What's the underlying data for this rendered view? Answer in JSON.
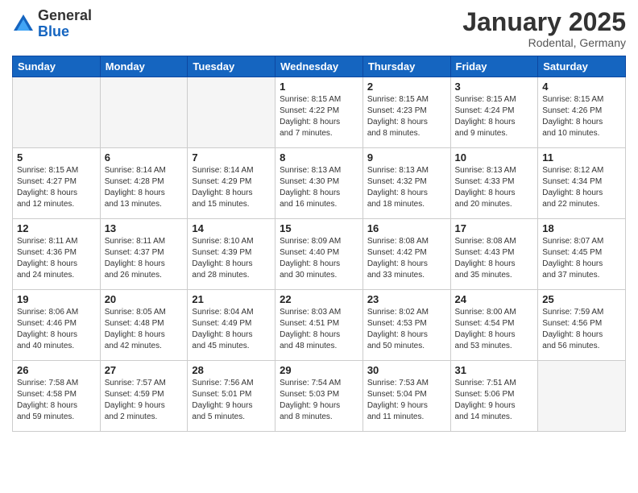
{
  "logo": {
    "general": "General",
    "blue": "Blue"
  },
  "title": "January 2025",
  "location": "Rodental, Germany",
  "days": [
    "Sunday",
    "Monday",
    "Tuesday",
    "Wednesday",
    "Thursday",
    "Friday",
    "Saturday"
  ],
  "weeks": [
    [
      {
        "day": "",
        "content": ""
      },
      {
        "day": "",
        "content": ""
      },
      {
        "day": "",
        "content": ""
      },
      {
        "day": "1",
        "content": "Sunrise: 8:15 AM\nSunset: 4:22 PM\nDaylight: 8 hours\nand 7 minutes."
      },
      {
        "day": "2",
        "content": "Sunrise: 8:15 AM\nSunset: 4:23 PM\nDaylight: 8 hours\nand 8 minutes."
      },
      {
        "day": "3",
        "content": "Sunrise: 8:15 AM\nSunset: 4:24 PM\nDaylight: 8 hours\nand 9 minutes."
      },
      {
        "day": "4",
        "content": "Sunrise: 8:15 AM\nSunset: 4:26 PM\nDaylight: 8 hours\nand 10 minutes."
      }
    ],
    [
      {
        "day": "5",
        "content": "Sunrise: 8:15 AM\nSunset: 4:27 PM\nDaylight: 8 hours\nand 12 minutes."
      },
      {
        "day": "6",
        "content": "Sunrise: 8:14 AM\nSunset: 4:28 PM\nDaylight: 8 hours\nand 13 minutes."
      },
      {
        "day": "7",
        "content": "Sunrise: 8:14 AM\nSunset: 4:29 PM\nDaylight: 8 hours\nand 15 minutes."
      },
      {
        "day": "8",
        "content": "Sunrise: 8:13 AM\nSunset: 4:30 PM\nDaylight: 8 hours\nand 16 minutes."
      },
      {
        "day": "9",
        "content": "Sunrise: 8:13 AM\nSunset: 4:32 PM\nDaylight: 8 hours\nand 18 minutes."
      },
      {
        "day": "10",
        "content": "Sunrise: 8:13 AM\nSunset: 4:33 PM\nDaylight: 8 hours\nand 20 minutes."
      },
      {
        "day": "11",
        "content": "Sunrise: 8:12 AM\nSunset: 4:34 PM\nDaylight: 8 hours\nand 22 minutes."
      }
    ],
    [
      {
        "day": "12",
        "content": "Sunrise: 8:11 AM\nSunset: 4:36 PM\nDaylight: 8 hours\nand 24 minutes."
      },
      {
        "day": "13",
        "content": "Sunrise: 8:11 AM\nSunset: 4:37 PM\nDaylight: 8 hours\nand 26 minutes."
      },
      {
        "day": "14",
        "content": "Sunrise: 8:10 AM\nSunset: 4:39 PM\nDaylight: 8 hours\nand 28 minutes."
      },
      {
        "day": "15",
        "content": "Sunrise: 8:09 AM\nSunset: 4:40 PM\nDaylight: 8 hours\nand 30 minutes."
      },
      {
        "day": "16",
        "content": "Sunrise: 8:08 AM\nSunset: 4:42 PM\nDaylight: 8 hours\nand 33 minutes."
      },
      {
        "day": "17",
        "content": "Sunrise: 8:08 AM\nSunset: 4:43 PM\nDaylight: 8 hours\nand 35 minutes."
      },
      {
        "day": "18",
        "content": "Sunrise: 8:07 AM\nSunset: 4:45 PM\nDaylight: 8 hours\nand 37 minutes."
      }
    ],
    [
      {
        "day": "19",
        "content": "Sunrise: 8:06 AM\nSunset: 4:46 PM\nDaylight: 8 hours\nand 40 minutes."
      },
      {
        "day": "20",
        "content": "Sunrise: 8:05 AM\nSunset: 4:48 PM\nDaylight: 8 hours\nand 42 minutes."
      },
      {
        "day": "21",
        "content": "Sunrise: 8:04 AM\nSunset: 4:49 PM\nDaylight: 8 hours\nand 45 minutes."
      },
      {
        "day": "22",
        "content": "Sunrise: 8:03 AM\nSunset: 4:51 PM\nDaylight: 8 hours\nand 48 minutes."
      },
      {
        "day": "23",
        "content": "Sunrise: 8:02 AM\nSunset: 4:53 PM\nDaylight: 8 hours\nand 50 minutes."
      },
      {
        "day": "24",
        "content": "Sunrise: 8:00 AM\nSunset: 4:54 PM\nDaylight: 8 hours\nand 53 minutes."
      },
      {
        "day": "25",
        "content": "Sunrise: 7:59 AM\nSunset: 4:56 PM\nDaylight: 8 hours\nand 56 minutes."
      }
    ],
    [
      {
        "day": "26",
        "content": "Sunrise: 7:58 AM\nSunset: 4:58 PM\nDaylight: 8 hours\nand 59 minutes."
      },
      {
        "day": "27",
        "content": "Sunrise: 7:57 AM\nSunset: 4:59 PM\nDaylight: 9 hours\nand 2 minutes."
      },
      {
        "day": "28",
        "content": "Sunrise: 7:56 AM\nSunset: 5:01 PM\nDaylight: 9 hours\nand 5 minutes."
      },
      {
        "day": "29",
        "content": "Sunrise: 7:54 AM\nSunset: 5:03 PM\nDaylight: 9 hours\nand 8 minutes."
      },
      {
        "day": "30",
        "content": "Sunrise: 7:53 AM\nSunset: 5:04 PM\nDaylight: 9 hours\nand 11 minutes."
      },
      {
        "day": "31",
        "content": "Sunrise: 7:51 AM\nSunset: 5:06 PM\nDaylight: 9 hours\nand 14 minutes."
      },
      {
        "day": "",
        "content": ""
      }
    ]
  ]
}
